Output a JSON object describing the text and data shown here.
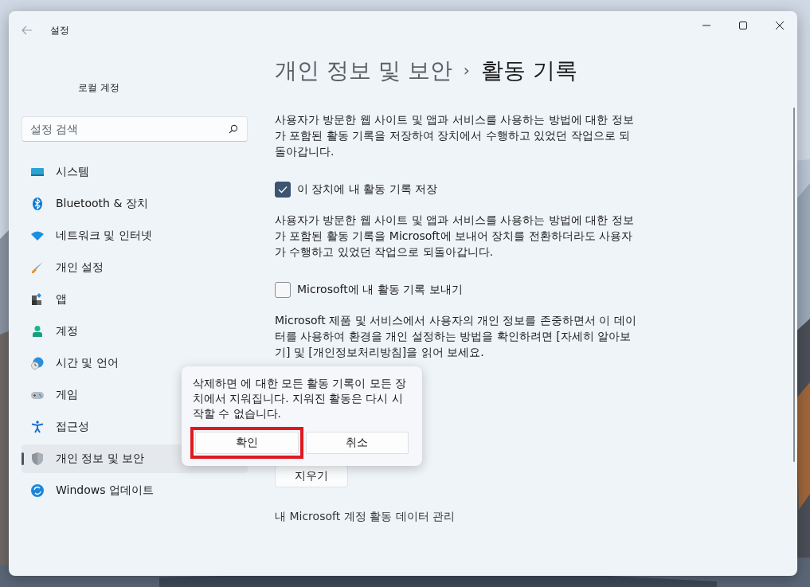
{
  "window": {
    "title": "설정"
  },
  "sidebar": {
    "account_name": "로컬 계정",
    "search": {
      "placeholder": "설정 검색"
    },
    "items": [
      {
        "label": "시스템",
        "selected": false
      },
      {
        "label": "Bluetooth & 장치",
        "selected": false
      },
      {
        "label": "네트워크 및 인터넷",
        "selected": false
      },
      {
        "label": "개인 설정",
        "selected": false
      },
      {
        "label": "앱",
        "selected": false
      },
      {
        "label": "계정",
        "selected": false
      },
      {
        "label": "시간 및 언어",
        "selected": false
      },
      {
        "label": "게임",
        "selected": false
      },
      {
        "label": "접근성",
        "selected": false
      },
      {
        "label": "개인 정보 및 보안",
        "selected": true
      },
      {
        "label": "Windows 업데이트",
        "selected": false
      }
    ]
  },
  "breadcrumb": {
    "parent": "개인 정보 및 보안",
    "separator": "›",
    "current": "활동 기록"
  },
  "content": [
    {
      "kind": "paragraph",
      "text": "사용자가 방문한 웹 사이트 및 앱과 서비스를 사용하는 방법에 대한 정보가 포함된 활동 기록을 저장하여 장치에서 수행하고 있었던 작업으로 되돌아갑니다."
    },
    {
      "kind": "checkbox",
      "text": "이 장치에 내 활동 기록 저장",
      "checked": true
    },
    {
      "kind": "paragraph",
      "text": "사용자가 방문한 웹 사이트 및 앱과 서비스를 사용하는 방법에 대한 정보가 포함된 활동 기록을 Microsoft에 보내어 장치를 전환하더라도 사용자가 수행하고 있었던 작업으로 되돌아갑니다."
    },
    {
      "kind": "checkbox",
      "text": "Microsoft에 내 활동 기록 보내기",
      "checked": false
    },
    {
      "kind": "paragraph",
      "text": "Microsoft 제품 및 서비스에서 사용자의 개인 정보를 존중하면서 이 데이터를 사용하여 환경을 개인 설정하는 방법을 확인하려면 [자세히 알아보기] 및 [개인정보처리방침]을 읽어 보세요."
    }
  ],
  "clear_button": "지우기",
  "manage_link": "내 Microsoft 계정 활동 데이터 관리",
  "dialog": {
    "message": "삭제하면 에 대한 모든 활동 기록이 모든 장치에서 지워집니다. 지워진 활동은 다시 시작할 수 없습니다.",
    "buttons": [
      {
        "label": "확인",
        "highlighted": true
      },
      {
        "label": "취소",
        "highlighted": false
      }
    ]
  }
}
